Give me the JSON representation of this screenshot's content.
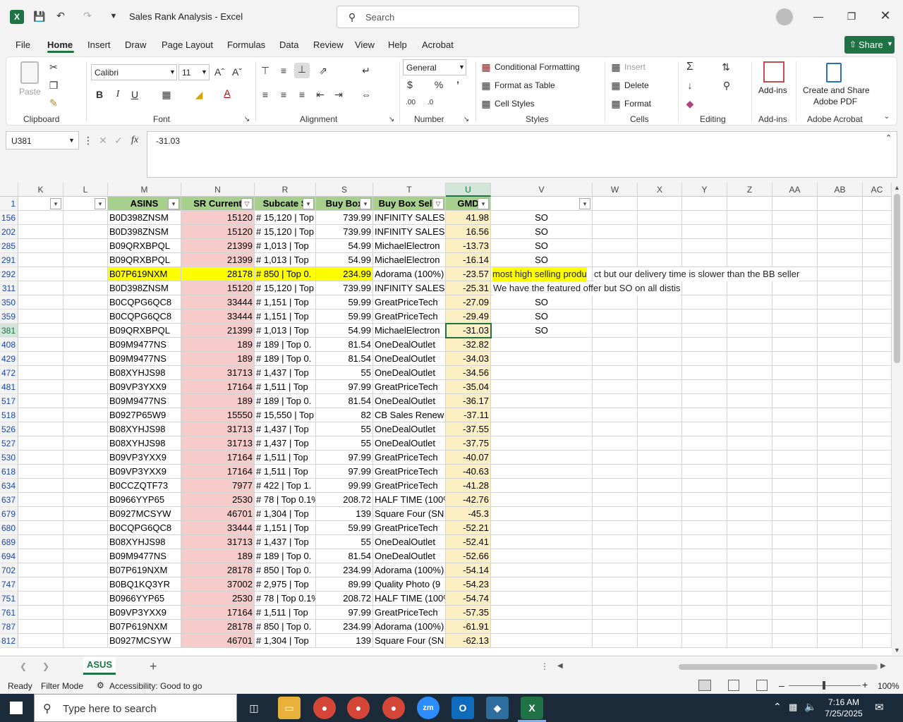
{
  "window": {
    "title": "Sales Rank Analysis  -  Excel"
  },
  "search": {
    "label": "Search"
  },
  "menu": {
    "items": [
      "File",
      "Home",
      "Insert",
      "Draw",
      "Page Layout",
      "Formulas",
      "Data",
      "Review",
      "View",
      "Help",
      "Acrobat"
    ],
    "share": "Share"
  },
  "ribbon": {
    "clipboard": {
      "label": "Clipboard",
      "paste": "Paste"
    },
    "font": {
      "label": "Font",
      "name": "Calibri",
      "size": "11"
    },
    "alignment": {
      "label": "Alignment"
    },
    "number": {
      "label": "Number",
      "format": "General"
    },
    "styles": {
      "label": "Styles",
      "conditional": "Conditional Formatting",
      "format_table": "Format as Table",
      "cell_styles": "Cell Styles"
    },
    "cells": {
      "label": "Cells",
      "insert": "Insert",
      "delete": "Delete",
      "format": "Format"
    },
    "editing": {
      "label": "Editing"
    },
    "addins": {
      "label": "Add-ins",
      "button": "Add-ins"
    },
    "acrobat": {
      "label": "Adobe Acrobat",
      "button_line1": "Create and Share",
      "button_line2": "Adobe PDF"
    }
  },
  "formula_bar": {
    "name_box": "U381",
    "value": "-31.03"
  },
  "columns": [
    "K",
    "L",
    "M",
    "N",
    "R",
    "S",
    "T",
    "U",
    "V",
    "W",
    "X",
    "Y",
    "Z",
    "AA",
    "AB",
    "AC"
  ],
  "header_row": {
    "row": "1",
    "M": "ASINS",
    "N": "SR Current",
    "R": "Subcate S",
    "S": "Buy Box",
    "T": "Buy Box Selle",
    "U": "GMD"
  },
  "rows": [
    {
      "row": "156",
      "M": "B0D398ZNSM",
      "N": "15120",
      "R": "# 15,120 | Top",
      "S": "739.99",
      "T": "INFINITY SALES",
      "U": "41.98",
      "V": "SO"
    },
    {
      "row": "202",
      "M": "B0D398ZNSM",
      "N": "15120",
      "R": "# 15,120 | Top",
      "S": "739.99",
      "T": "INFINITY SALES",
      "U": "16.56",
      "V": "SO"
    },
    {
      "row": "285",
      "M": "B09QRXBPQL",
      "N": "21399",
      "R": "# 1,013 | Top",
      "S": "54.99",
      "T": "MichaelElectron",
      "U": "-13.73",
      "V": "SO"
    },
    {
      "row": "291",
      "M": "B09QRXBPQL",
      "N": "21399",
      "R": "# 1,013 | Top",
      "S": "54.99",
      "T": "MichaelElectron",
      "U": "-16.14",
      "V": "SO"
    },
    {
      "row": "292",
      "M": "B07P619NXM",
      "N": "28178",
      "R": "# 850 | Top 0.",
      "S": "234.99",
      "T": "Adorama (100%)",
      "U": "-23.57",
      "V_note_hl": "most high selling produ",
      "V_note_rest": "ct but our delivery time is slower than the BB seller"
    },
    {
      "row": "311",
      "M": "B0D398ZNSM",
      "N": "15120",
      "R": "# 15,120 | Top",
      "S": "739.99",
      "T": "INFINITY SALES",
      "U": "-25.31",
      "V_note": "We have the featured offer but SO on all distis"
    },
    {
      "row": "350",
      "M": "B0CQPG6QC8",
      "N": "33444",
      "R": "# 1,151 | Top",
      "S": "59.99",
      "T": "GreatPriceTech",
      "U": "-27.09",
      "V": "SO"
    },
    {
      "row": "359",
      "M": "B0CQPG6QC8",
      "N": "33444",
      "R": "# 1,151 | Top",
      "S": "59.99",
      "T": "GreatPriceTech",
      "U": "-29.49",
      "V": "SO"
    },
    {
      "row": "381",
      "M": "B09QRXBPQL",
      "N": "21399",
      "R": "# 1,013 | Top",
      "S": "54.99",
      "T": "MichaelElectron",
      "U": "-31.03",
      "V": "SO"
    },
    {
      "row": "408",
      "M": "B09M9477NS",
      "N": "189",
      "R": "# 189 | Top 0.",
      "S": "81.54",
      "T": "OneDealOutlet",
      "U": "-32.82"
    },
    {
      "row": "429",
      "M": "B09M9477NS",
      "N": "189",
      "R": "# 189 | Top 0.",
      "S": "81.54",
      "T": "OneDealOutlet",
      "U": "-34.03"
    },
    {
      "row": "472",
      "M": "B08XYHJS98",
      "N": "31713",
      "R": "# 1,437 | Top",
      "S": "55",
      "T": "OneDealOutlet",
      "U": "-34.56"
    },
    {
      "row": "481",
      "M": "B09VP3YXX9",
      "N": "17164",
      "R": "# 1,511 | Top",
      "S": "97.99",
      "T": "GreatPriceTech",
      "U": "-35.04"
    },
    {
      "row": "517",
      "M": "B09M9477NS",
      "N": "189",
      "R": "# 189 | Top 0.",
      "S": "81.54",
      "T": "OneDealOutlet",
      "U": "-36.17"
    },
    {
      "row": "518",
      "M": "B0927P65W9",
      "N": "15550",
      "R": "# 15,550 | Top",
      "S": "82",
      "T": "CB Sales Renew",
      "U": "-37.11"
    },
    {
      "row": "526",
      "M": "B08XYHJS98",
      "N": "31713",
      "R": "# 1,437 | Top",
      "S": "55",
      "T": "OneDealOutlet",
      "U": "-37.55"
    },
    {
      "row": "527",
      "M": "B08XYHJS98",
      "N": "31713",
      "R": "# 1,437 | Top",
      "S": "55",
      "T": "OneDealOutlet",
      "U": "-37.75"
    },
    {
      "row": "530",
      "M": "B09VP3YXX9",
      "N": "17164",
      "R": "# 1,511 | Top",
      "S": "97.99",
      "T": "GreatPriceTech",
      "U": "-40.07"
    },
    {
      "row": "618",
      "M": "B09VP3YXX9",
      "N": "17164",
      "R": "# 1,511 | Top",
      "S": "97.99",
      "T": "GreatPriceTech",
      "U": "-40.63"
    },
    {
      "row": "634",
      "M": "B0CCZQTF73",
      "N": "7977",
      "R": "# 422 | Top 1.",
      "S": "99.99",
      "T": "GreatPriceTech",
      "U": "-41.28"
    },
    {
      "row": "637",
      "M": "B0966YYP65",
      "N": "2530",
      "R": "# 78 | Top 0.1%",
      "S": "208.72",
      "T": "HALF TIME (100%",
      "U": "-42.76"
    },
    {
      "row": "679",
      "M": "B0927MCSYW",
      "N": "46701",
      "R": "# 1,304 | Top",
      "S": "139",
      "T": "Square Four (SN",
      "U": "-45.3"
    },
    {
      "row": "680",
      "M": "B0CQPG6QC8",
      "N": "33444",
      "R": "# 1,151 | Top",
      "S": "59.99",
      "T": "GreatPriceTech",
      "U": "-52.21"
    },
    {
      "row": "689",
      "M": "B08XYHJS98",
      "N": "31713",
      "R": "# 1,437 | Top",
      "S": "55",
      "T": "OneDealOutlet",
      "U": "-52.41"
    },
    {
      "row": "694",
      "M": "B09M9477NS",
      "N": "189",
      "R": "# 189 | Top 0.",
      "S": "81.54",
      "T": "OneDealOutlet",
      "U": "-52.66"
    },
    {
      "row": "702",
      "M": "B07P619NXM",
      "N": "28178",
      "R": "# 850 | Top 0.",
      "S": "234.99",
      "T": "Adorama (100%)",
      "U": "-54.14"
    },
    {
      "row": "747",
      "M": "B0BQ1KQ3YR",
      "N": "37002",
      "R": "# 2,975 | Top",
      "S": "89.99",
      "T": "Quality Photo (9",
      "U": "-54.23"
    },
    {
      "row": "751",
      "M": "B0966YYP65",
      "N": "2530",
      "R": "# 78 | Top 0.1%",
      "S": "208.72",
      "T": "HALF TIME (100%",
      "U": "-54.74"
    },
    {
      "row": "761",
      "M": "B09VP3YXX9",
      "N": "17164",
      "R": "# 1,511 | Top",
      "S": "97.99",
      "T": "GreatPriceTech",
      "U": "-57.35"
    },
    {
      "row": "787",
      "M": "B07P619NXM",
      "N": "28178",
      "R": "# 850 | Top 0.",
      "S": "234.99",
      "T": "Adorama (100%)",
      "U": "-61.91"
    },
    {
      "row": "812",
      "M": "B0927MCSYW",
      "N": "46701",
      "R": "# 1,304 | Top",
      "S": "139",
      "T": "Square Four (SN",
      "U": "-62.13"
    }
  ],
  "sheet": {
    "tab": "ASUS",
    "add": "+"
  },
  "status": {
    "ready": "Ready",
    "filter_mode": "Filter Mode",
    "accessibility": "Accessibility: Good to go",
    "zoom": "100%"
  },
  "taskbar": {
    "search_placeholder": "Type here to search",
    "time": "7:16 AM",
    "date": "7/25/2025"
  }
}
